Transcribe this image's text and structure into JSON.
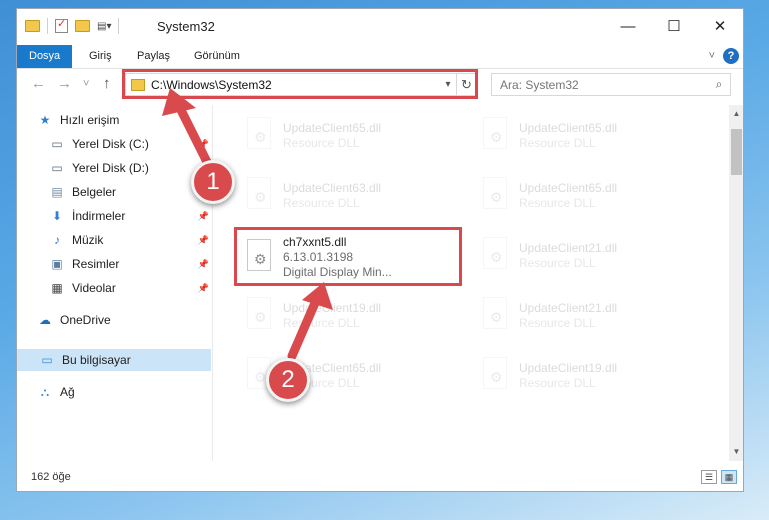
{
  "window": {
    "title": "System32",
    "controls": {
      "minimize": "—",
      "maximize": "☐",
      "close": "✕"
    }
  },
  "ribbon": {
    "tabs": [
      {
        "label": "Dosya",
        "active": true
      },
      {
        "label": "Giriş"
      },
      {
        "label": "Paylaş"
      },
      {
        "label": "Görünüm"
      }
    ],
    "help": "?"
  },
  "nav": {
    "back": "←",
    "forward": "→",
    "recent": "˅",
    "up": "↑",
    "address": "C:\\Windows\\System32",
    "search_placeholder": "Ara: System32"
  },
  "sidebar": {
    "items": [
      {
        "label": "Hızlı erişim",
        "icon": "star-icon",
        "glyph": "★",
        "color": "#2f7fd4"
      },
      {
        "label": "Yerel Disk (C:)",
        "icon": "drive-icon",
        "glyph": "▭",
        "color": "#5b6b7a",
        "pinned": true
      },
      {
        "label": "Yerel Disk (D:)",
        "icon": "drive-icon",
        "glyph": "▭",
        "color": "#5b6b7a",
        "pinned": true
      },
      {
        "label": "Belgeler",
        "icon": "documents-icon",
        "glyph": "▤",
        "color": "#6f8aa3",
        "pinned": true
      },
      {
        "label": "İndirmeler",
        "icon": "download-icon",
        "glyph": "⬇",
        "color": "#2f7fd4",
        "pinned": true
      },
      {
        "label": "Müzik",
        "icon": "music-icon",
        "glyph": "♪",
        "color": "#2f7fd4",
        "pinned": true
      },
      {
        "label": "Resimler",
        "icon": "pictures-icon",
        "glyph": "▣",
        "color": "#5b7fa0",
        "pinned": true
      },
      {
        "label": "Videolar",
        "icon": "videos-icon",
        "glyph": "▦",
        "color": "#444",
        "pinned": true
      },
      {
        "label": "OneDrive",
        "icon": "cloud-icon",
        "glyph": "☁",
        "color": "#1f6fc0"
      },
      {
        "label": "Bu bilgisayar",
        "icon": "computer-icon",
        "glyph": "▭",
        "color": "#3a8fd8",
        "selected": true
      },
      {
        "label": "Ağ",
        "icon": "network-icon",
        "glyph": "⛬",
        "color": "#3a8fd8"
      }
    ]
  },
  "files": {
    "left": [
      {
        "name": "UpdateClient65.dll",
        "sub": "Resource DLL",
        "faded": true
      },
      {
        "name": "UpdateClient63.dll",
        "sub": "Resource DLL",
        "faded": true
      },
      {
        "name": "ch7xxnt5.dll",
        "version": "6.13.01.3198",
        "sub": "Digital Display Min...",
        "faded": false
      },
      {
        "name": "UpdateClient19.dll",
        "sub": "Resource DLL",
        "faded": true
      },
      {
        "name": "UpdateClient65.dll",
        "sub": "Resource DLL",
        "faded": true
      }
    ],
    "right": [
      {
        "name": "UpdateClient65.dll",
        "sub": "Resource DLL",
        "faded": true
      },
      {
        "name": "UpdateClient65.dll",
        "sub": "Resource DLL",
        "faded": true
      },
      {
        "name": "UpdateClient21.dll",
        "sub": "Resource DLL",
        "faded": true
      },
      {
        "name": "UpdateClient21.dll",
        "sub": "Resource DLL",
        "faded": true
      },
      {
        "name": "UpdateClient19.dll",
        "sub": "Resource DLL",
        "faded": true
      }
    ]
  },
  "status": {
    "count": "162 öğe"
  },
  "annotations": {
    "step1": "1",
    "step2": "2",
    "color": "#d9484c"
  }
}
